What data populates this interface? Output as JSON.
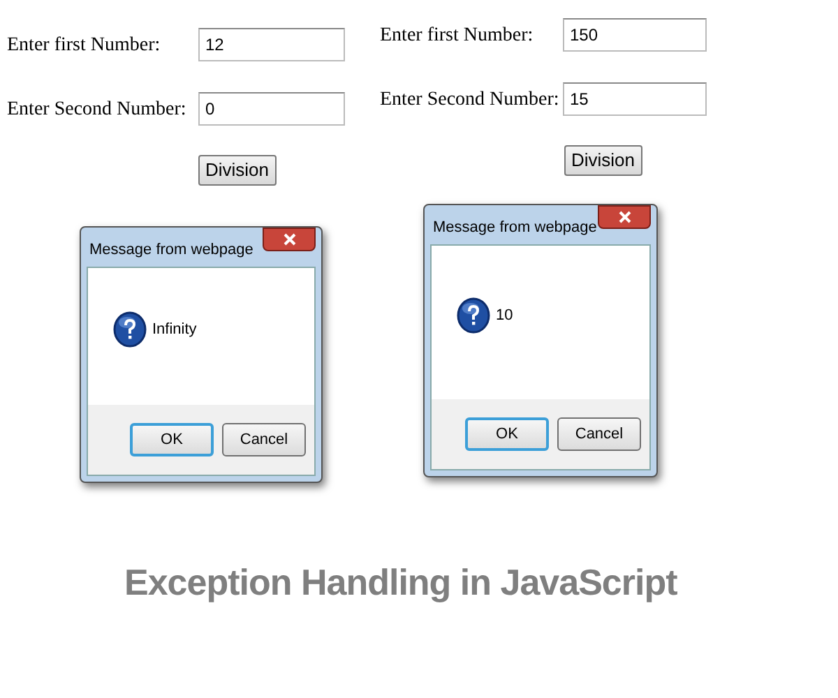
{
  "panels": [
    {
      "fields": [
        {
          "label": "Enter first Number:",
          "value": "12"
        },
        {
          "label": "Enter Second Number:",
          "value": "0"
        }
      ],
      "button": "Division",
      "dialog": {
        "title": "Message from webpage",
        "message": "Infinity",
        "buttons": [
          {
            "label": "OK",
            "default": true
          },
          {
            "label": "Cancel",
            "default": false
          }
        ]
      }
    },
    {
      "fields": [
        {
          "label": "Enter first Number:",
          "value": "150"
        },
        {
          "label": "Enter Second Number:",
          "value": "15"
        }
      ],
      "button": "Division",
      "dialog": {
        "title": "Message from webpage",
        "message": "10",
        "buttons": [
          {
            "label": "OK",
            "default": true
          },
          {
            "label": "Cancel",
            "default": false
          }
        ]
      }
    }
  ],
  "caption": "Exception Handling in JavaScript"
}
